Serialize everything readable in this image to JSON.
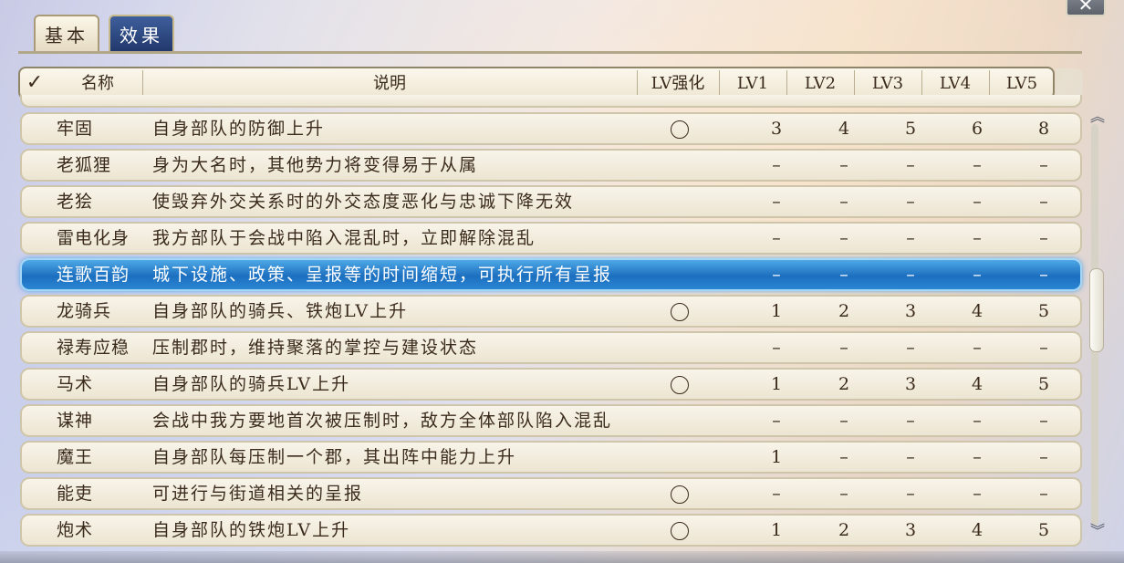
{
  "window": {
    "close_symbol": "✕"
  },
  "tabs": [
    {
      "label": "基本",
      "active": false
    },
    {
      "label": "效果",
      "active": true
    }
  ],
  "header": {
    "check_symbol": "✓",
    "name": "名称",
    "description": "说明",
    "lv_enhance": "LV强化",
    "lv1": "LV1",
    "lv2": "LV2",
    "lv3": "LV3",
    "lv4": "LV4",
    "lv5": "LV5"
  },
  "rows": [
    {
      "name": "牢固",
      "desc": "自身部队的防御上升",
      "enhance": true,
      "lv": [
        "3",
        "4",
        "5",
        "6",
        "8"
      ]
    },
    {
      "name": "老狐狸",
      "desc": "身为大名时，其他势力将变得易于从属",
      "enhance": false,
      "lv": [
        "–",
        "–",
        "–",
        "–",
        "–"
      ]
    },
    {
      "name": "老狯",
      "desc": "使毁弃外交关系时的外交态度恶化与忠诚下降无效",
      "enhance": false,
      "lv": [
        "–",
        "–",
        "–",
        "–",
        "–"
      ]
    },
    {
      "name": "雷电化身",
      "desc": "我方部队于会战中陷入混乱时，立即解除混乱",
      "enhance": false,
      "lv": [
        "–",
        "–",
        "–",
        "–",
        "–"
      ]
    },
    {
      "name": "连歌百韵",
      "desc": "城下设施、政策、呈报等的时间缩短，可执行所有呈报",
      "enhance": false,
      "lv": [
        "–",
        "–",
        "–",
        "–",
        "–"
      ]
    },
    {
      "name": "龙骑兵",
      "desc": "自身部队的骑兵、铁炮LV上升",
      "enhance": true,
      "lv": [
        "1",
        "2",
        "3",
        "4",
        "5"
      ]
    },
    {
      "name": "禄寿应稳",
      "desc": "压制郡时，维持聚落的掌控与建设状态",
      "enhance": false,
      "lv": [
        "–",
        "–",
        "–",
        "–",
        "–"
      ]
    },
    {
      "name": "马术",
      "desc": "自身部队的骑兵LV上升",
      "enhance": true,
      "lv": [
        "1",
        "2",
        "3",
        "4",
        "5"
      ]
    },
    {
      "name": "谋神",
      "desc": "会战中我方要地首次被压制时，敌方全体部队陷入混乱",
      "enhance": false,
      "lv": [
        "–",
        "–",
        "–",
        "–",
        "–"
      ]
    },
    {
      "name": "魔王",
      "desc": "自身部队每压制一个郡，其出阵中能力上升",
      "enhance": false,
      "lv": [
        "1",
        "–",
        "–",
        "–",
        "–"
      ]
    },
    {
      "name": "能吏",
      "desc": "可进行与街道相关的呈报",
      "enhance": true,
      "lv": [
        "–",
        "–",
        "–",
        "–",
        "–"
      ]
    },
    {
      "name": "炮术",
      "desc": "自身部队的铁炮LV上升",
      "enhance": true,
      "lv": [
        "1",
        "2",
        "3",
        "4",
        "5"
      ]
    }
  ],
  "selected_row": 4,
  "scroll": {
    "up_symbol": "︽",
    "down_symbol": "︾",
    "position": 0.45
  }
}
